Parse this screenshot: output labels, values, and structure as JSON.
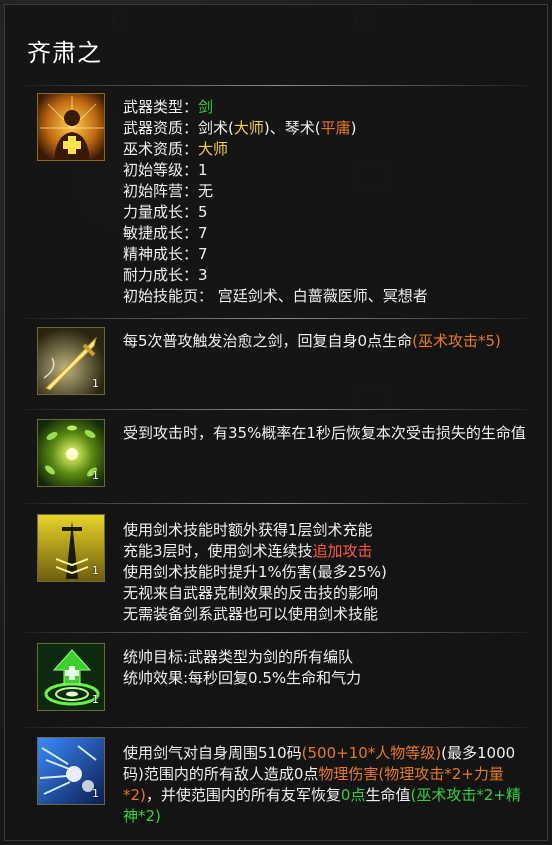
{
  "title": "齐肃之",
  "info": {
    "weapon_type_label": "武器类型：",
    "weapon_type_value": "剑",
    "weapon_quality_label": "武器资质：",
    "weapon_quality_a": "剑术(",
    "weapon_quality_a_grade": "大师",
    "weapon_quality_mid": ")、琴术(",
    "weapon_quality_b_grade": "平庸",
    "weapon_quality_end": ")",
    "sorcery_label": "巫术资质：",
    "sorcery_value": "大师",
    "lines": [
      "初始等级：1",
      "初始阵营：无",
      "力量成长：5",
      "敏捷成长：7",
      "精神成长：7",
      "耐力成长：3",
      "初始技能页： 宫廷剑术、白蔷薇医师、冥想者"
    ]
  },
  "skills": [
    {
      "icon": "golden-sword-icon",
      "level": "1",
      "text_a": "每5次普攻触发治愈之剑，回复自身0点生命",
      "text_b": "(巫术攻击*5)"
    },
    {
      "icon": "green-leaves-icon",
      "level": "1",
      "text": "受到攻击时，有35%概率在1秒后恢复本次受击损失的生命值"
    },
    {
      "icon": "yellow-blade-icon",
      "level": "1",
      "line1": "使用剑术技能时额外获得1层剑术充能",
      "line2a": "充能3层时，使用剑术连续技",
      "line2b": "追加攻击",
      "line3": "使用剑术技能时提升1%伤害(最多25%)",
      "line4": "无视来自武器克制效果的反击技的影响",
      "line5": "无需装备剑系武器也可以使用剑术技能"
    },
    {
      "icon": "green-heal-aura-icon",
      "level": "1",
      "line1": "统帅目标:武器类型为剑的所有编队",
      "line2": "统帅效果:每秒回复0.5%生命和气力"
    },
    {
      "icon": "sword-qi-blast-icon",
      "level": "1",
      "p1": "使用剑气对自身周围510码",
      "p2": "(500+10*人物等级)",
      "p3": "(最多1000码)范围内的所有敌人造成0点",
      "p4": "物理伤害(物理攻击*2+力量*2)",
      "p5": "，并使范围内的所有友军恢复",
      "p6": "0点",
      "p7": "生命值",
      "p8": "(巫术攻击*2+精神*2)"
    }
  ]
}
